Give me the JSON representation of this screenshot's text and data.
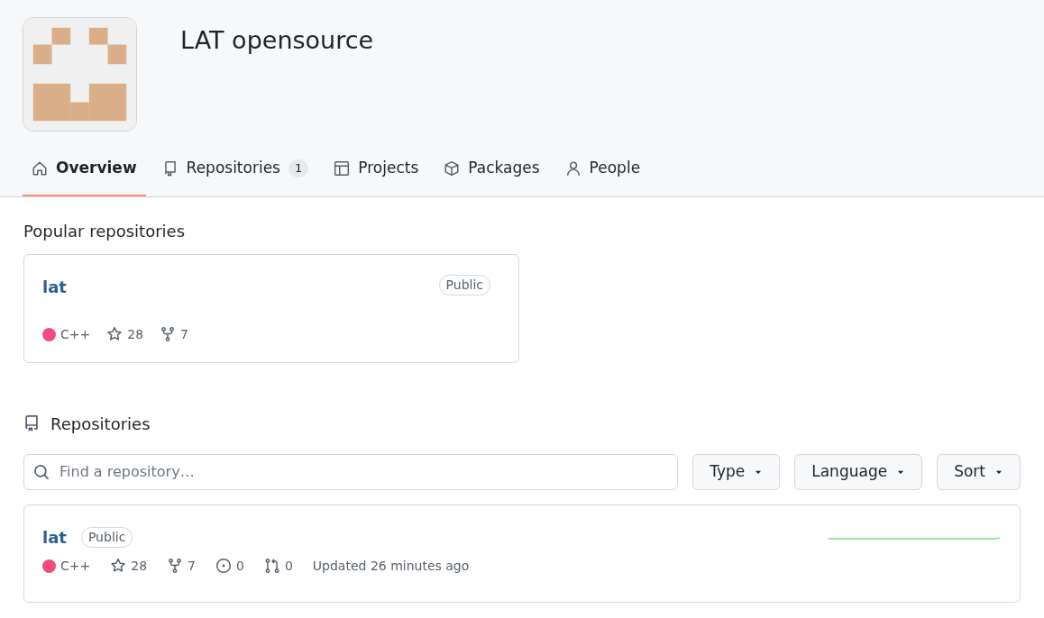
{
  "org": {
    "name": "LAT opensource"
  },
  "tabs": [
    {
      "label": "Overview",
      "selected": true
    },
    {
      "label": "Repositories",
      "selected": false,
      "counter": "1"
    },
    {
      "label": "Projects",
      "selected": false
    },
    {
      "label": "Packages",
      "selected": false
    },
    {
      "label": "People",
      "selected": false
    }
  ],
  "popular": {
    "heading": "Popular repositories",
    "cards": [
      {
        "name": "lat",
        "visibility": "Public",
        "language": "C++",
        "color": "#f34b7d",
        "stars": "28",
        "forks": "7"
      }
    ]
  },
  "repositories": {
    "heading": "Repositories",
    "search": {
      "placeholder": "Find a repository…"
    },
    "filters": [
      "Type",
      "Language",
      "Sort"
    ],
    "items": [
      {
        "name": "lat",
        "visibility": "Public",
        "language": "C++",
        "color": "#f34b7d",
        "stars": "28",
        "forks": "7",
        "issues": "0",
        "pulls": "0",
        "updated": "Updated 26 minutes ago"
      }
    ]
  }
}
